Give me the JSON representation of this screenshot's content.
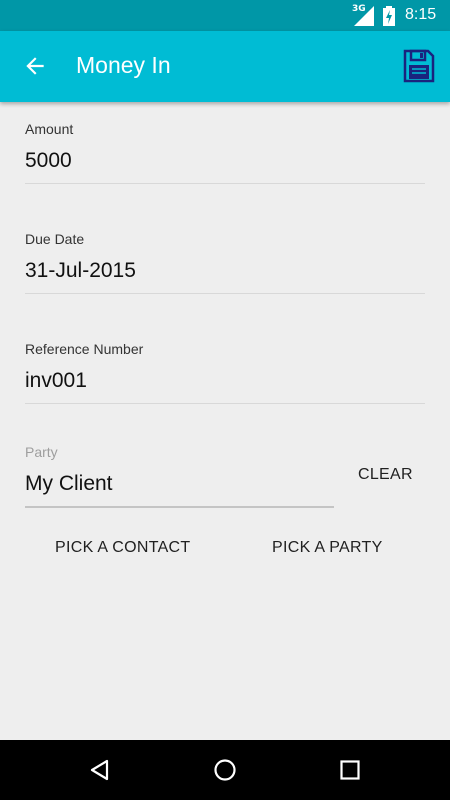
{
  "status_bar": {
    "network": "3G",
    "time": "8:15"
  },
  "app_bar": {
    "title": "Money In"
  },
  "fields": [
    {
      "label": "Amount",
      "value": "5000"
    },
    {
      "label": "Due Date",
      "value": "31-Jul-2015"
    },
    {
      "label": "Reference Number",
      "value": "inv001"
    }
  ],
  "party": {
    "label": "Party",
    "value": "My Client"
  },
  "buttons": {
    "clear": "CLEAR",
    "pick_contact": "PICK A CONTACT",
    "pick_party": "PICK A PARTY"
  },
  "colors": {
    "status_bar": "#0097a7",
    "app_bar": "#00bcd4",
    "background": "#eeeeee",
    "nav_bar": "#000000"
  }
}
